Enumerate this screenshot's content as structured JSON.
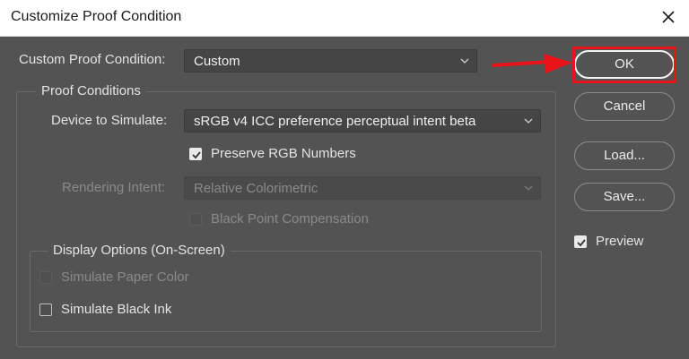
{
  "window": {
    "title": "Customize Proof Condition"
  },
  "custom_condition": {
    "label": "Custom Proof Condition:",
    "value": "Custom"
  },
  "proof_conditions": {
    "legend": "Proof Conditions",
    "device_label": "Device to Simulate:",
    "device_value": "sRGB v4 ICC preference perceptual intent beta",
    "preserve_rgb": {
      "label": "Preserve RGB Numbers",
      "checked": true
    },
    "rendering_intent_label": "Rendering Intent:",
    "rendering_intent_value": "Relative Colorimetric",
    "black_point": {
      "label": "Black Point Compensation",
      "checked": false,
      "enabled": false
    }
  },
  "display_options": {
    "legend": "Display Options (On-Screen)",
    "paper_color": {
      "label": "Simulate Paper Color",
      "checked": false,
      "enabled": false
    },
    "black_ink": {
      "label": "Simulate Black Ink",
      "checked": false,
      "enabled": true
    }
  },
  "buttons": {
    "ok": "OK",
    "cancel": "Cancel",
    "load": "Load...",
    "save": "Save..."
  },
  "preview": {
    "label": "Preview",
    "checked": true
  },
  "icons": {
    "close": "close-icon",
    "dropdown": "chevron-down-icon",
    "check": "checkmark-icon",
    "annotation": "arrow-right-icon"
  },
  "colors": {
    "dialog_bg": "#535353",
    "highlight": "#e8141a"
  }
}
